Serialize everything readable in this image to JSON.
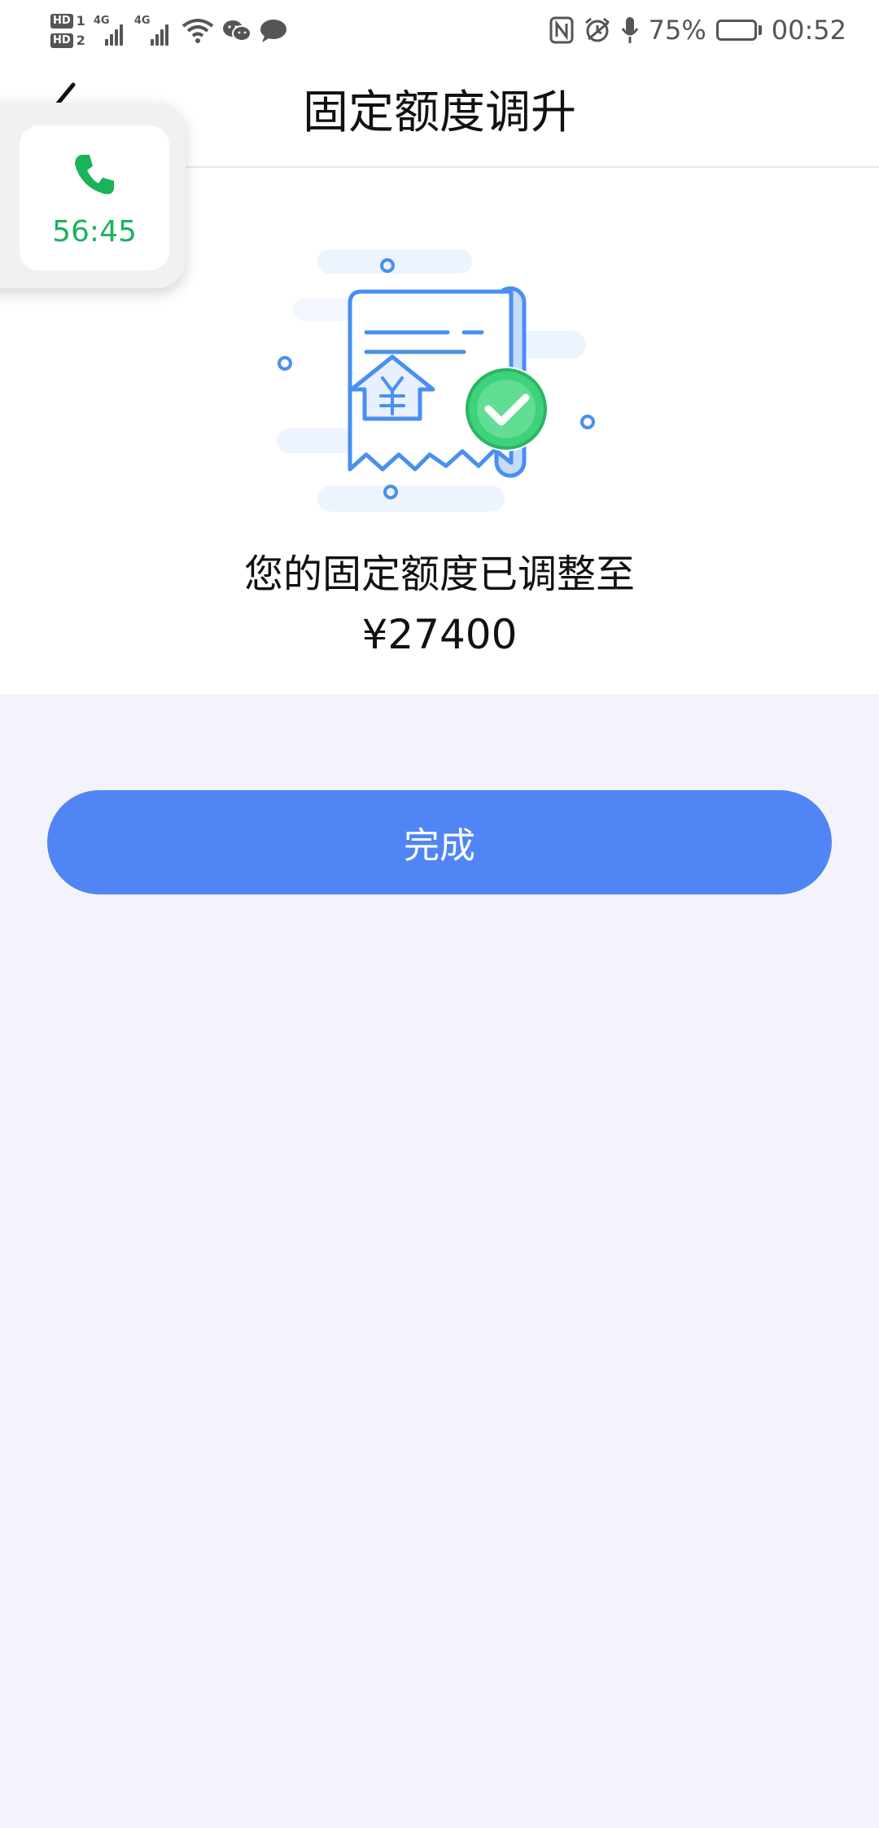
{
  "status_bar": {
    "sim1_label": "HD",
    "sim1_number": "1",
    "sim2_label": "HD",
    "sim2_number": "2",
    "network1": "4G",
    "network2": "4G",
    "battery_percent": "75%",
    "battery_level": 0.75,
    "time": "00:52",
    "icons": [
      "signal-icon",
      "signal-icon",
      "wifi-icon",
      "wechat-icon",
      "message-icon",
      "nfc-icon",
      "alarm-icon",
      "microphone-icon",
      "battery-icon"
    ]
  },
  "header": {
    "title": "固定额度调升",
    "back_icon": "back-arrow-icon"
  },
  "call_bubble": {
    "icon": "phone-icon",
    "duration": "56:45",
    "accent_color": "#19b35a"
  },
  "result": {
    "illustration": "receipt-success-illustration",
    "message": "您的固定额度已调整至",
    "amount": "¥27400"
  },
  "actions": {
    "done_label": "完成",
    "button_color": "#5185f5"
  }
}
